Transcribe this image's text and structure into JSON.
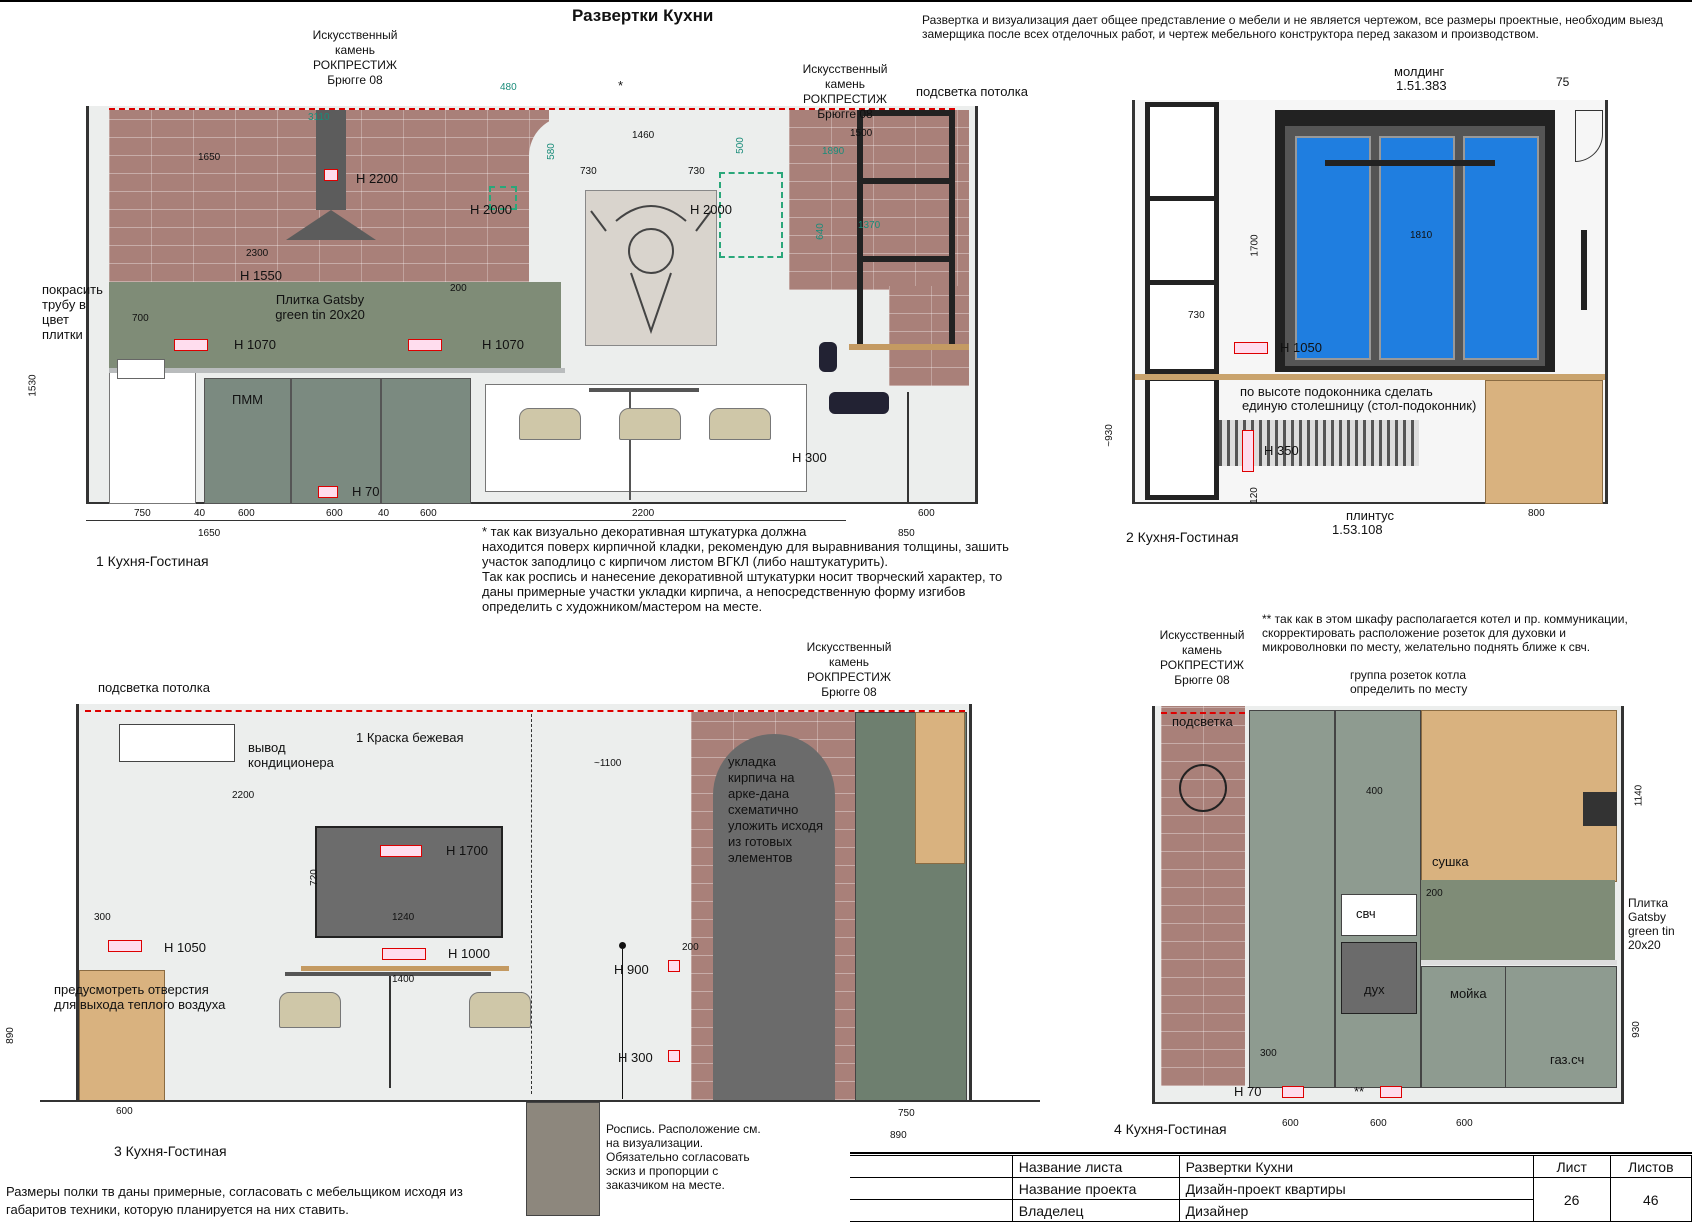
{
  "header": {
    "title": "Развертки Кухни",
    "disclaimer_1": "Развертка и визуализация дает общее представление о мебели и не является чертежом, все размеры проектные, необходим выезд",
    "disclaimer_2": "замерщика после всех отделочных работ, и чертеж мебельного конструктора перед заказом и производством."
  },
  "view1": {
    "label": "1 Кухня-Гостиная",
    "stone_note_1": "Искусственный камень РОКПРЕСТИЖ Брюгге 08",
    "stone_note_2": "Искусственный камень РОКПРЕСТИЖ Брюгге 08",
    "ceiling_light": "подсветка потолка",
    "paint_pipe": "покрасить трубу в цвет плитки",
    "tile": "Плитка Gatsby green tin 20х20",
    "pmm": "ПММ",
    "star": "*",
    "heights": [
      "H 2200",
      "H 1550",
      "H 1070",
      "H 1070",
      "H 2000",
      "H 2000",
      "H 300",
      "H 70"
    ],
    "dims": {
      "d480": "480",
      "d3110": "3110",
      "d1650a": "1650",
      "d2300": "2300",
      "d200": "200",
      "d700": "700",
      "d1530": "1530",
      "d580": "580",
      "d1460": "1460",
      "d730a": "730",
      "d730b": "730",
      "d500": "500",
      "d1500": "1500",
      "d1890": "1890",
      "d640": "640",
      "d1370": "1370",
      "bottom": [
        "750",
        "40",
        "600",
        "600",
        "40",
        "600"
      ],
      "d1650b": "1650",
      "d2200": "2200",
      "d600": "600",
      "d850": "850"
    }
  },
  "note_star": [
    "* так как визуально декоративная штукатурка должна",
    "находится поверх кирпичной кладки, рекомендую для выравнивания толщины, зашить",
    "участок заподлицо с кирпичом листом ВГКЛ (либо наштукатурить).",
    "Так как роспись и нанесение декоративной штукатурки носит творческий характер, то",
    "даны примерные участки укладки кирпича, а непосредственную форму изгибов",
    "определить с художником/мастером на месте."
  ],
  "view2": {
    "label": "2 Кухня-Гостиная",
    "molding": "молдинг",
    "molding_code": "1.51.383",
    "d75": "75",
    "d1700": "1700",
    "d1810": "1810",
    "d730": "730",
    "h1050": "H 1050",
    "sill_note_1": "по высоте подоконника сделать",
    "sill_note_2": "единую столешницу (стол-подоконник)",
    "h350": "H 350",
    "d930": "~930",
    "d120": "120",
    "d800": "800",
    "plinth": "плинтус",
    "plinth_code": "1.53.108"
  },
  "view3": {
    "label": "3 Кухня-Гостиная",
    "ceiling_light": "подсветка потолка",
    "stone_note": "Искусственный камень РОКПРЕСТИЖ Брюгге 08",
    "ac_outlet": "вывод кондиционера",
    "paint": "1 Краска бежевая",
    "d2200": "2200",
    "d1100": "~1100",
    "arch_note": "укладка кирпича на арке-дана схематично уложить исходя из готовых элементов",
    "h1700": "H 1700",
    "d720": "720",
    "d1240": "1240",
    "d300": "300",
    "h1050": "H 1050",
    "h1000": "H 1000",
    "d1400": "1400",
    "d200": "200",
    "h900": "H 900",
    "h300": "H 300",
    "holes_note": "предусмотреть отверстия для выхода теплого воздуха",
    "d890a": "890",
    "d600": "600",
    "d750": "750",
    "d890b": "890",
    "mural_note": "Роспись. Расположение см. на визуализации. Обязательно согласовать эскиз и пропорции с заказчиком на месте.",
    "shelf_note_1": "Размеры полки тв даны примерные, согласовать с мебельщиком исходя из",
    "shelf_note_2": "габаритов техники, которую планируется на них ставить."
  },
  "view4": {
    "label": "4 Кухня-Гостиная",
    "stone_note": "Искусственный камень РОКПРЕСТИЖ Брюгге 08",
    "boiler_note": "** так как в этом шкафу располагается котел и пр. коммуникации, скорректировать расположение розеток для духовки и микроволновки по месту, желательно поднять ближе к свч.",
    "boiler_sockets": "группа розеток котла определить по месту",
    "backlight": "подсветка",
    "d400": "400",
    "d1140": "1140",
    "drying": "сушка",
    "d200": "200",
    "mw": "свч",
    "tile": "Плитка Gatsby green tin 20х20",
    "oven": "дух",
    "sink": "мойка",
    "d930": "930",
    "d300": "300",
    "gas": "газ.сч",
    "h70": "H 70",
    "stars": "**",
    "bottom": [
      "600",
      "600",
      "600"
    ]
  },
  "stamp": {
    "sheet_name_label": "Название листа",
    "sheet_name": "Развертки Кухни",
    "project_label": "Название проекта",
    "project": "Дизайн-проект квартиры",
    "owner_label": "Владелец",
    "designer": "Дизайнер",
    "sheet_label": "Лист",
    "sheets_label": "Листов",
    "sheet": "26",
    "sheets": "46"
  }
}
